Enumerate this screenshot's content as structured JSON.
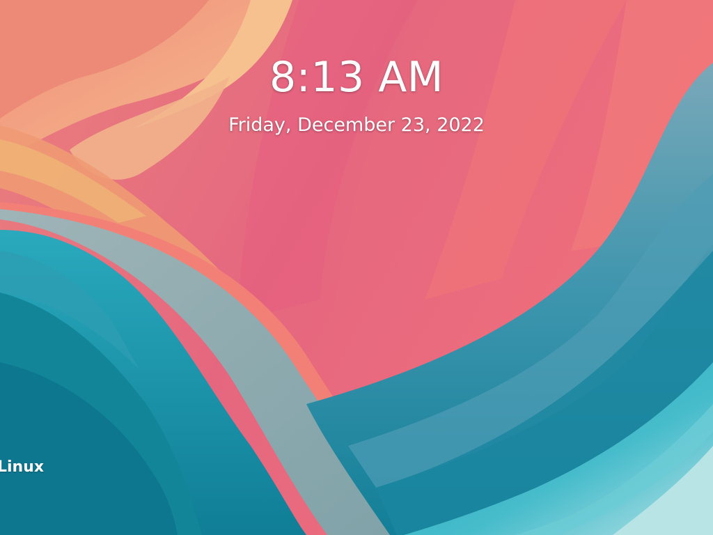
{
  "lock_screen": {
    "time": "8:13 AM",
    "date": "Friday, December 23, 2022",
    "brand_text": "Linux"
  },
  "wallpaper": {
    "description_colors": [
      "#f4b98f",
      "#ef8f7c",
      "#e86a80",
      "#f27a78",
      "#8fb0b6",
      "#2a9bb0",
      "#127f98",
      "#5fc6d2",
      "#b6e3e6"
    ]
  }
}
